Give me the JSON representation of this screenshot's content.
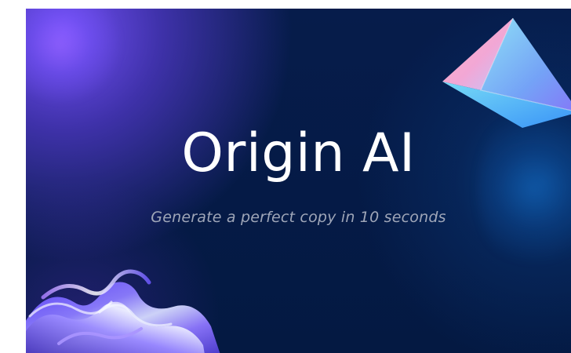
{
  "hero": {
    "title": "Origin AI",
    "subtitle": "Generate a perfect copy in 10 seconds"
  },
  "colors": {
    "background": "#061c4b",
    "title": "#ffffff",
    "subtitle": "#9fa6b8",
    "accent_purple": "#7a54ff",
    "accent_blue": "#1470cd",
    "pyramid_pink": "#f5b5c5",
    "pyramid_blue": "#8dd8ff"
  },
  "decorations": {
    "top_right": "pyramid-shape",
    "bottom_left": "iridescent-swirl"
  }
}
